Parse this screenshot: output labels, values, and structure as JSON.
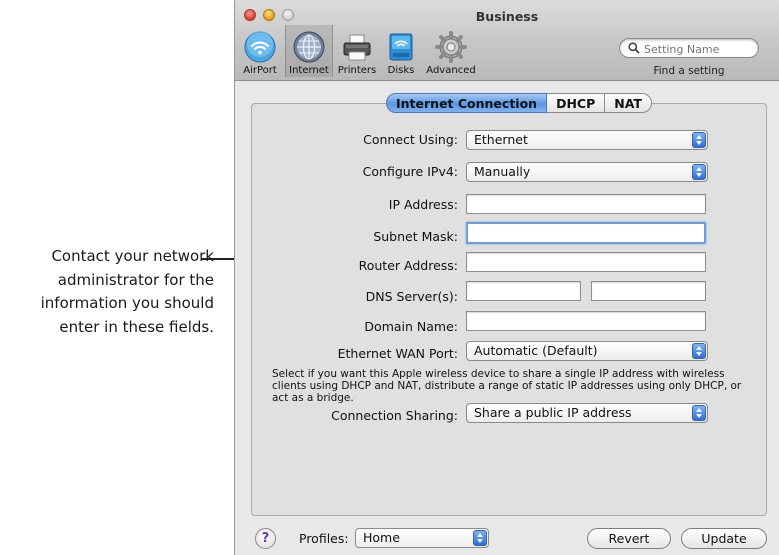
{
  "callout": {
    "lines": [
      "Contact your network",
      "administrator for the",
      "information you should",
      "enter in these fields."
    ]
  },
  "window": {
    "title": "Business",
    "toolbar": [
      {
        "label": "AirPort",
        "icon": "airport-icon"
      },
      {
        "label": "Internet",
        "icon": "internet-globe-icon",
        "selected": true
      },
      {
        "label": "Printers",
        "icon": "printer-icon"
      },
      {
        "label": "Disks",
        "icon": "disk-icon"
      },
      {
        "label": "Advanced",
        "icon": "gear-icon"
      }
    ],
    "search": {
      "placeholder": "Setting Name",
      "caption": "Find a setting"
    }
  },
  "tabs": [
    {
      "label": "Internet Connection",
      "active": true
    },
    {
      "label": "DHCP",
      "active": false
    },
    {
      "label": "NAT",
      "active": false
    }
  ],
  "form": {
    "connect_using": {
      "label": "Connect Using:",
      "value": "Ethernet"
    },
    "configure_ipv4": {
      "label": "Configure IPv4:",
      "value": "Manually"
    },
    "ip_address": {
      "label": "IP Address:",
      "value": ""
    },
    "subnet_mask": {
      "label": "Subnet Mask:",
      "value": ""
    },
    "router_address": {
      "label": "Router Address:",
      "value": ""
    },
    "dns_servers": {
      "label": "DNS Server(s):",
      "value1": "",
      "value2": ""
    },
    "domain_name": {
      "label": "Domain Name:",
      "value": ""
    },
    "wan_port": {
      "label": "Ethernet WAN Port:",
      "value": "Automatic (Default)"
    },
    "sharing_description": "Select if you want this Apple wireless device to share a single IP address with wireless clients using DHCP and NAT, distribute a range of static IP addresses using only DHCP, or act as a bridge.",
    "connection_sharing": {
      "label": "Connection Sharing:",
      "value": "Share a public IP address"
    }
  },
  "footer": {
    "help": "?",
    "profiles_label": "Profiles:",
    "profile_value": "Home",
    "revert": "Revert",
    "update": "Update"
  },
  "colors": {
    "tab_active": "#5a97e6",
    "popup_arrow": "#2d6fd7",
    "focus_ring": "#6f9ddc",
    "close": "#e0463a",
    "minimize": "#eba318"
  }
}
